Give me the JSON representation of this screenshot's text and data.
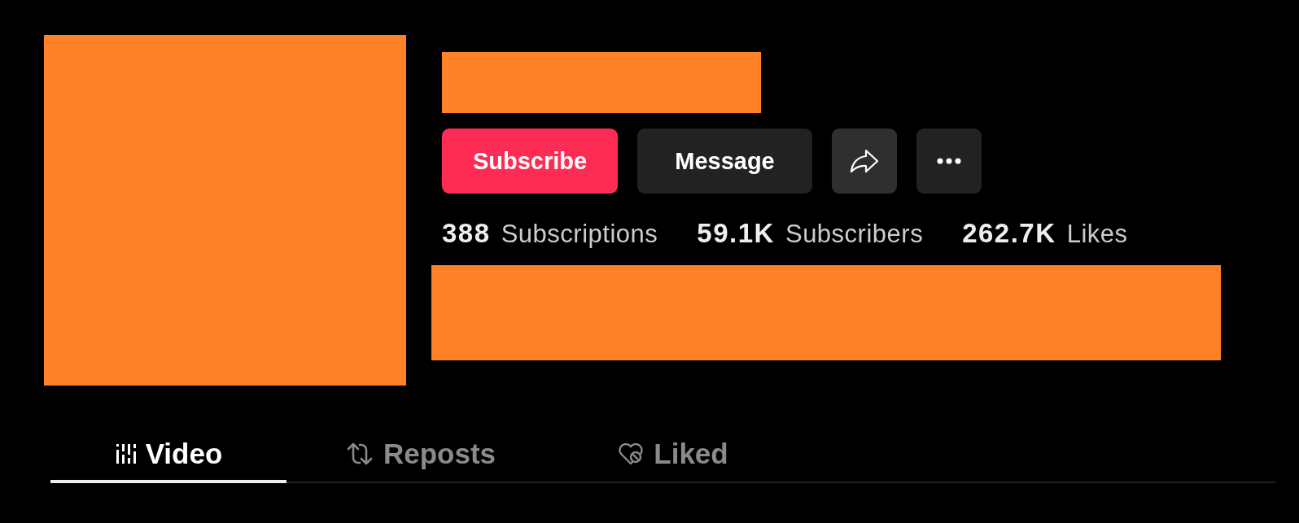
{
  "actions": [
    {
      "kind": "primary",
      "label": "Subscribe"
    },
    {
      "kind": "secondary",
      "label": "Message"
    },
    {
      "kind": "share"
    },
    {
      "kind": "more"
    }
  ],
  "stats": [
    {
      "text": "**388** Subscriptions"
    },
    {
      "text": "**59.1K** Subscribers"
    },
    {
      "text": "**262.7K** Likes"
    }
  ],
  "tabs": [
    {
      "kind": "video",
      "label": "Video",
      "selected": true
    },
    {
      "kind": "reposts",
      "label": "Reposts",
      "selected": false
    },
    {
      "kind": "liked",
      "label": "Liked",
      "selected": false
    }
  ]
}
